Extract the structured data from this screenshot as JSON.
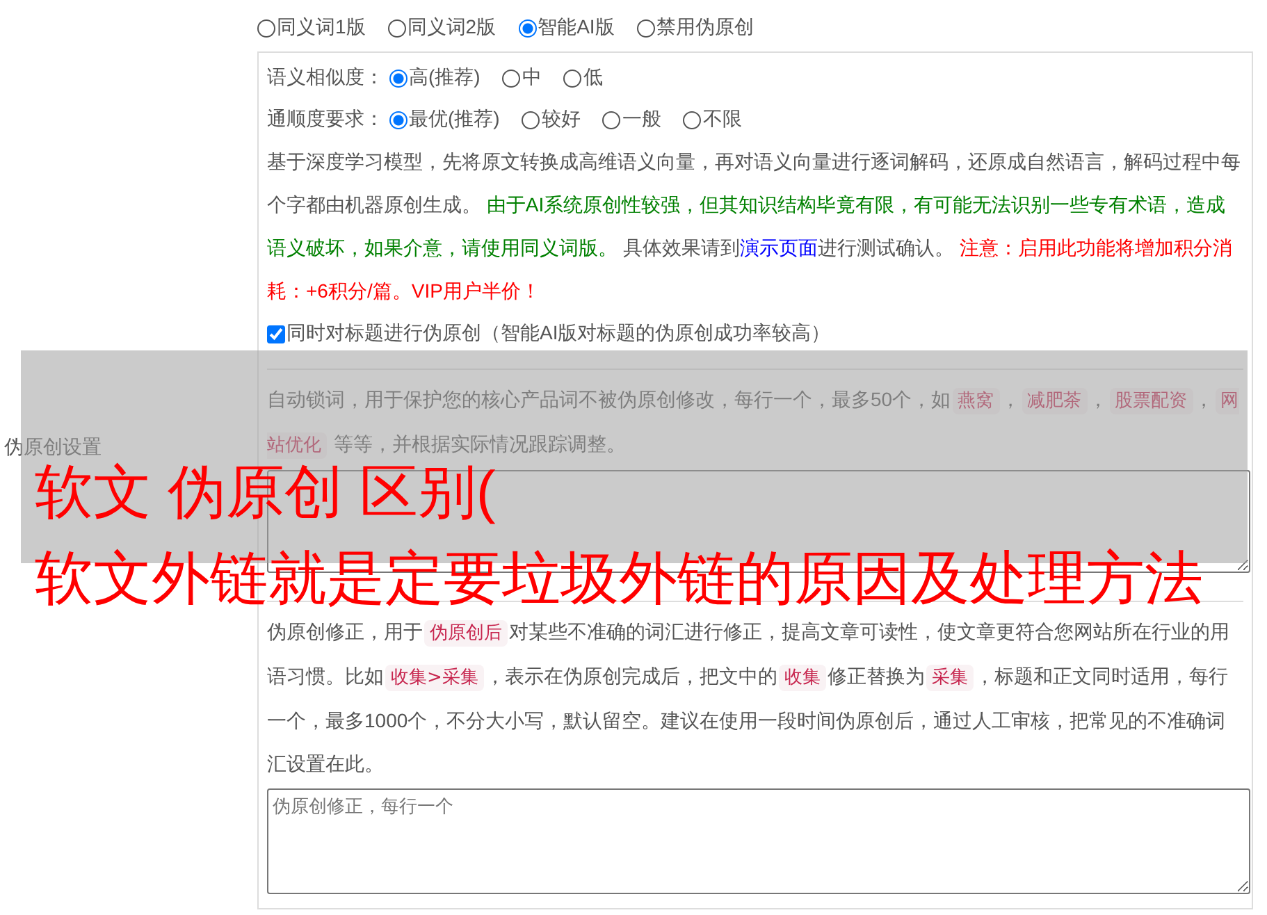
{
  "mode_options": [
    {
      "label": "同义词1版",
      "selected": false
    },
    {
      "label": "同义词2版",
      "selected": false
    },
    {
      "label": "智能AI版",
      "selected": true
    },
    {
      "label": "禁用伪原创",
      "selected": false
    }
  ],
  "similarity": {
    "label": "语义相似度：",
    "options": [
      {
        "label": "高(推荐)",
        "selected": true
      },
      {
        "label": "中",
        "selected": false
      },
      {
        "label": "低",
        "selected": false
      }
    ]
  },
  "fluency": {
    "label": "通顺度要求：",
    "options": [
      {
        "label": "最优(推荐)",
        "selected": true
      },
      {
        "label": "较好",
        "selected": false
      },
      {
        "label": "一般",
        "selected": false
      },
      {
        "label": "不限",
        "selected": false
      }
    ]
  },
  "ai_description": [
    {
      "kind": "plain",
      "text": "基于深度学习模型，先将原文转换成高维语义向量，再对语义向量进行逐词解码，还原成自然语言，解码过程中每个字都由机器原创生成。 "
    },
    {
      "kind": "caution",
      "text": "由于AI系统原创性较强，但其知识结构毕竟有限，有可能无法识别一些专有术语，造成语义破坏，如果介意，请使用同义词版。"
    },
    {
      "kind": "plain",
      "text": " 具体效果请到"
    },
    {
      "kind": "link",
      "text": "演示页面"
    },
    {
      "kind": "plain",
      "text": "进行测试确认。 "
    },
    {
      "kind": "warning",
      "text": "注意：启用此功能将增加积分消耗：+6积分/篇。VIP用户半价！"
    }
  ],
  "title_checkbox": {
    "label": "同时对标题进行伪原创（智能AI版对标题的伪原创成功率较高）",
    "checked": true
  },
  "section_label": "伪原创设置",
  "lock_words": {
    "description": [
      {
        "kind": "plain",
        "text": "自动锁词，用于保护您的核心产品词不被伪原创修改，每行一个，最多50个，如"
      },
      {
        "kind": "tag",
        "text": "燕窝"
      },
      {
        "kind": "plain",
        "text": "，"
      },
      {
        "kind": "tag",
        "text": "减肥茶"
      },
      {
        "kind": "plain",
        "text": "，"
      },
      {
        "kind": "tag",
        "text": "股票配资"
      },
      {
        "kind": "plain",
        "text": "，"
      },
      {
        "kind": "tag",
        "text": "网站优化"
      },
      {
        "kind": "plain",
        "text": " 等等，并根据实际情况跟踪调整。"
      }
    ]
  },
  "corrections": {
    "description": [
      {
        "kind": "plain",
        "text": "伪原创修正，用于"
      },
      {
        "kind": "tag",
        "text": "伪原创后"
      },
      {
        "kind": "plain",
        "text": "对某些不准确的词汇进行修正，提高文章可读性，使文章更符合您网站所在行业的用语习惯。比如"
      },
      {
        "kind": "tag",
        "text": "收集>采集"
      },
      {
        "kind": "plain",
        "text": "，表示在伪原创完成后，把文中的"
      },
      {
        "kind": "tag",
        "text": "收集"
      },
      {
        "kind": "plain",
        "text": "修正替换为"
      },
      {
        "kind": "tag",
        "text": "采集"
      },
      {
        "kind": "plain",
        "text": "，标题和正文同时适用，每行一个，最多1000个，不分大小写，默认留空。建议在使用一段时间伪原创后，通过人工审核，把常见的不准确词汇设置在此。"
      }
    ],
    "placeholder": "伪原创修正，每行一个"
  },
  "overlay": {
    "lines": [
      "软文 伪原创 区别(",
      "软文外链就是定要垃圾外链的原因及处理方法"
    ]
  }
}
